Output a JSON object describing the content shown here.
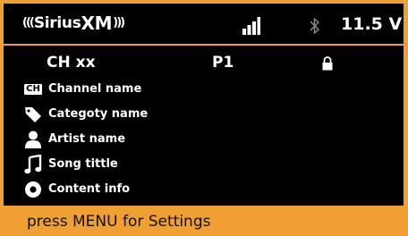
{
  "header": {
    "logo": "Sirius",
    "logo_suffix": "XM",
    "signal_icon": "signal-bars-icon",
    "bluetooth_icon": "bluetooth-icon",
    "voltage": "11.5 V"
  },
  "channel": {
    "number": "CH xx",
    "preset": "P1",
    "lock_icon": "lock-icon"
  },
  "info": {
    "ch_icon_text": "CH",
    "channel_name": "Channel name",
    "category_name": "Categoty name",
    "artist_name": "Artist name",
    "song_title": "Song tittle",
    "content_info": "Content info"
  },
  "footer": {
    "hint": "press MENU for Settings"
  },
  "colors": {
    "accent": "#f0a033",
    "screen_bg": "#000000",
    "text": "#ffffff",
    "bluetooth_dim": "#8a8a8a"
  }
}
